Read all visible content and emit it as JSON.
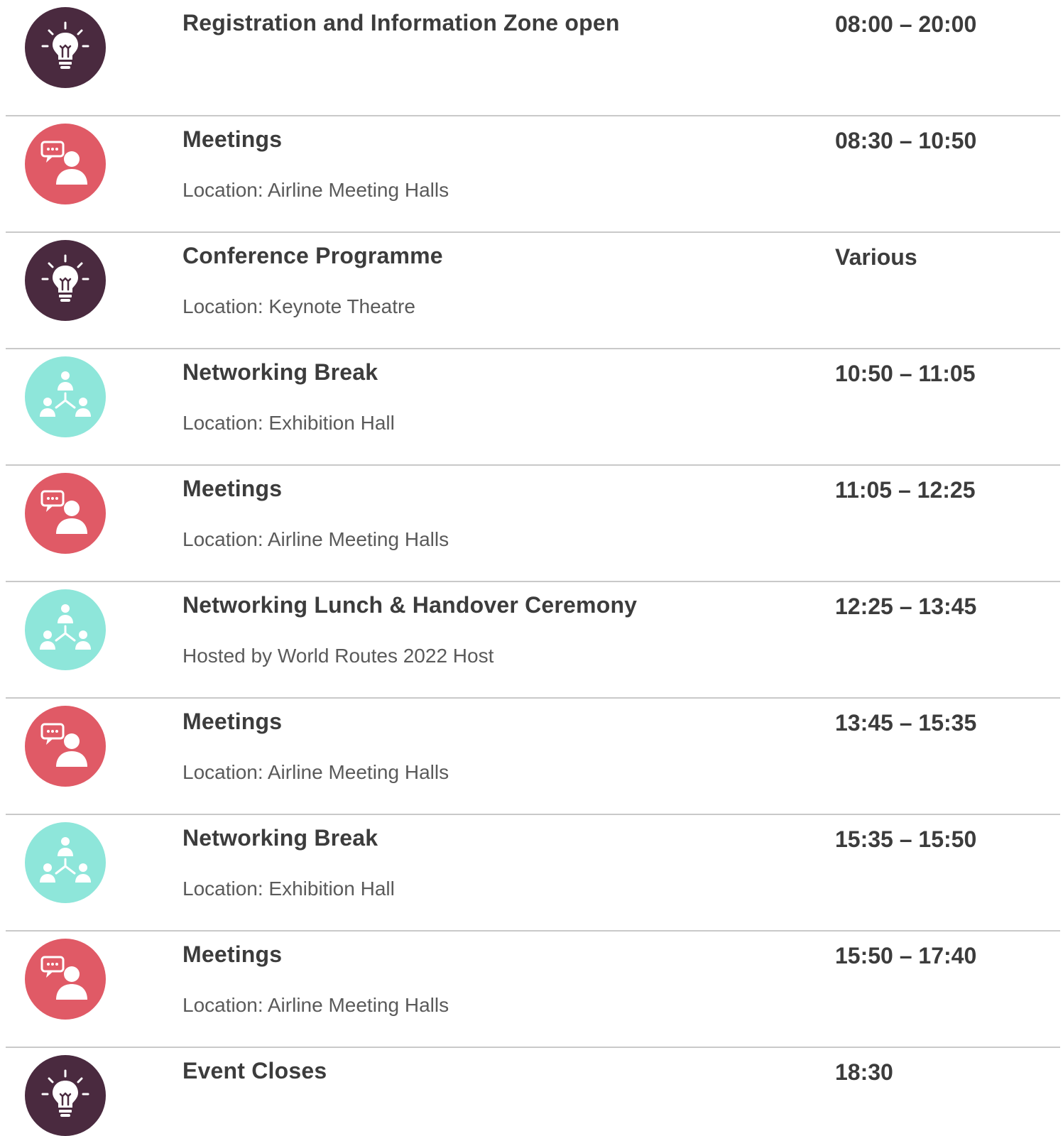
{
  "schedule": {
    "items": [
      {
        "icon": "lightbulb-icon",
        "title": "Registration and Information Zone open",
        "subtitle": "",
        "time": "08:00 – 20:00"
      },
      {
        "icon": "meeting-person-icon",
        "title": "Meetings",
        "subtitle": "Location: Airline Meeting Halls",
        "time": "08:30 – 10:50"
      },
      {
        "icon": "lightbulb-icon",
        "title": "Conference Programme",
        "subtitle": "Location: Keynote Theatre",
        "time": "Various"
      },
      {
        "icon": "networking-group-icon",
        "title": "Networking Break",
        "subtitle": "Location: Exhibition Hall",
        "time": "10:50 – 11:05"
      },
      {
        "icon": "meeting-person-icon",
        "title": "Meetings",
        "subtitle": "Location: Airline Meeting Halls",
        "time": "11:05 – 12:25"
      },
      {
        "icon": "networking-group-icon",
        "title": "Networking Lunch & Handover Ceremony",
        "subtitle": "Hosted by World Routes 2022 Host",
        "time": "12:25 – 13:45"
      },
      {
        "icon": "meeting-person-icon",
        "title": "Meetings",
        "subtitle": "Location: Airline Meeting Halls",
        "time": "13:45 – 15:35"
      },
      {
        "icon": "networking-group-icon",
        "title": "Networking Break",
        "subtitle": "Location: Exhibition Hall",
        "time": "15:35 – 15:50"
      },
      {
        "icon": "meeting-person-icon",
        "title": "Meetings",
        "subtitle": "Location: Airline Meeting Halls",
        "time": "15:50 – 17:40"
      },
      {
        "icon": "lightbulb-icon",
        "title": "Event Closes",
        "subtitle": "",
        "time": "18:30"
      }
    ]
  },
  "colors": {
    "idea": "#4a2a3f",
    "meeting": "#e05a66",
    "network": "#8ee6da",
    "divider": "#c9c9c9",
    "text": "#3c3c3c"
  }
}
